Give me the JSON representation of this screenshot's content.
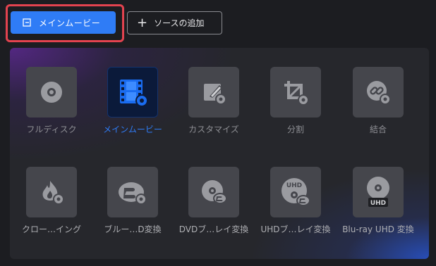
{
  "toolbar": {
    "main_movie_button": "メインムービー",
    "add_source_button": "ソースの追加",
    "plus_glyph": "+"
  },
  "colors": {
    "accent": "#2f7cf6",
    "highlight_border": "#e3434f",
    "tile_bg": "#45464c",
    "panel_bg": "#26272c"
  },
  "modes": [
    {
      "label": "フルディスク",
      "icon": "disc-icon",
      "active": false
    },
    {
      "label": "メインムービー",
      "icon": "film-icon",
      "active": true
    },
    {
      "label": "カスタマイズ",
      "icon": "edit-icon",
      "active": false
    },
    {
      "label": "分割",
      "icon": "crop-icon",
      "active": false
    },
    {
      "label": "結合",
      "icon": "link-icon",
      "active": false
    }
  ],
  "conversions": [
    {
      "label": "クロー…イング",
      "icon": "flame-disc-icon"
    },
    {
      "label": "ブルー…D変換",
      "icon": "bluray-icon"
    },
    {
      "label": "DVDブ…レイ変換",
      "icon": "dvd-bluray-icon"
    },
    {
      "label": "UHDブ…レイ変換",
      "icon": "uhd-bluray-icon"
    },
    {
      "label": "Blu-ray UHD 変換",
      "icon": "bluray-uhd-icon"
    }
  ],
  "uhd_text": "UHD"
}
